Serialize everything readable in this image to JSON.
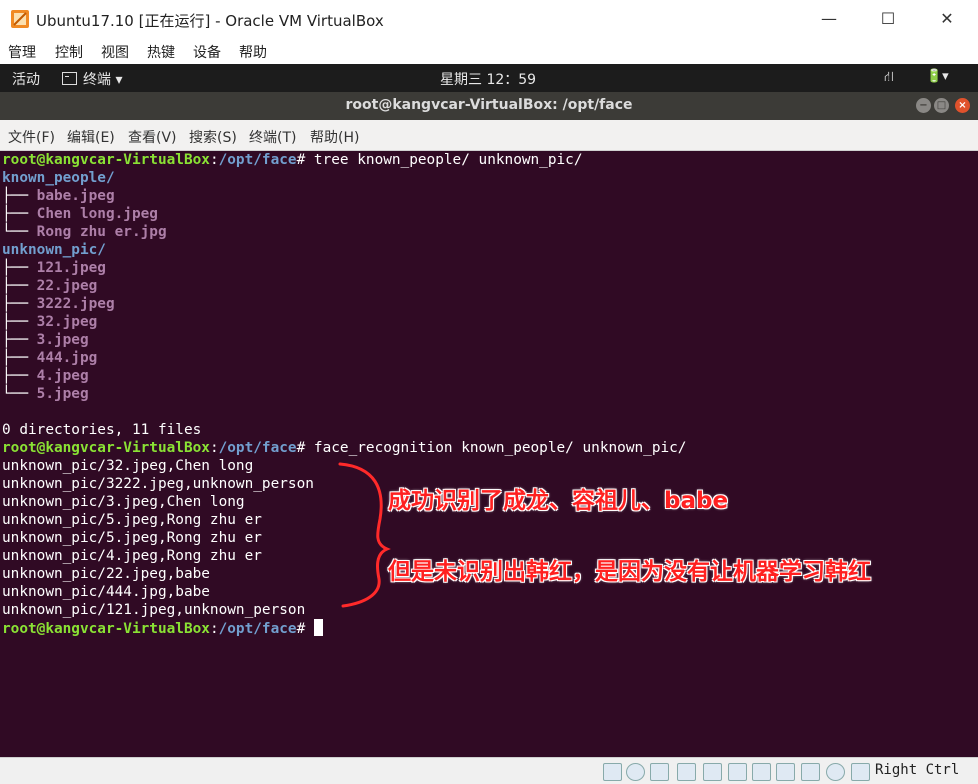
{
  "window": {
    "title": "Ubuntu17.10 [正在运行] - Oracle VM VirtualBox",
    "minimize": "—",
    "maximize": "☐",
    "close": "✕"
  },
  "vbox_menu": [
    "管理",
    "控制",
    "视图",
    "热键",
    "设备",
    "帮助"
  ],
  "ubuntu_bar": {
    "activities": "活动",
    "app_menu": "终端 ▾",
    "clock": "星期三 12：59",
    "network_icon": "⛙",
    "power_icon": "🔋▾"
  },
  "terminal": {
    "title": "root@kangvcar-VirtualBox: /opt/face",
    "menu": [
      "文件(F)",
      "编辑(E)",
      "查看(V)",
      "搜索(S)",
      "终端(T)",
      "帮助(H)"
    ],
    "prompt_user": "root@kangvcar-VirtualBox",
    "prompt_path": "/opt/face",
    "prompt_sep": ":",
    "prompt_end": "# ",
    "cmd1": "tree known_people/ unknown_pic/",
    "tree_dir1": "known_people/",
    "tree_dir1_files": [
      "babe.jpeg",
      "Chen long.jpeg",
      "Rong zhu er.jpg"
    ],
    "tree_dir2": "unknown_pic/",
    "tree_dir2_files": [
      "121.jpeg",
      "22.jpeg",
      "3222.jpeg",
      "32.jpeg",
      "3.jpeg",
      "444.jpg",
      "4.jpeg",
      "5.jpeg"
    ],
    "tree_summary": "0 directories, 11 files",
    "cmd2": "face_recognition known_people/ unknown_pic/",
    "results": [
      "unknown_pic/32.jpeg,Chen long",
      "unknown_pic/3222.jpeg,unknown_person",
      "unknown_pic/3.jpeg,Chen long",
      "unknown_pic/5.jpeg,Rong zhu er",
      "unknown_pic/5.jpeg,Rong zhu er",
      "unknown_pic/4.jpeg,Rong zhu er",
      "unknown_pic/22.jpeg,babe",
      "unknown_pic/444.jpg,babe",
      "unknown_pic/121.jpeg,unknown_person"
    ]
  },
  "annotations": {
    "line1": "成功识别了成龙、容祖儿、babe",
    "line2": "但是未识别出韩红，是因为没有让机器学习韩红",
    "color": "#ff2020"
  },
  "status_bar": {
    "host_key": "Right Ctrl"
  }
}
